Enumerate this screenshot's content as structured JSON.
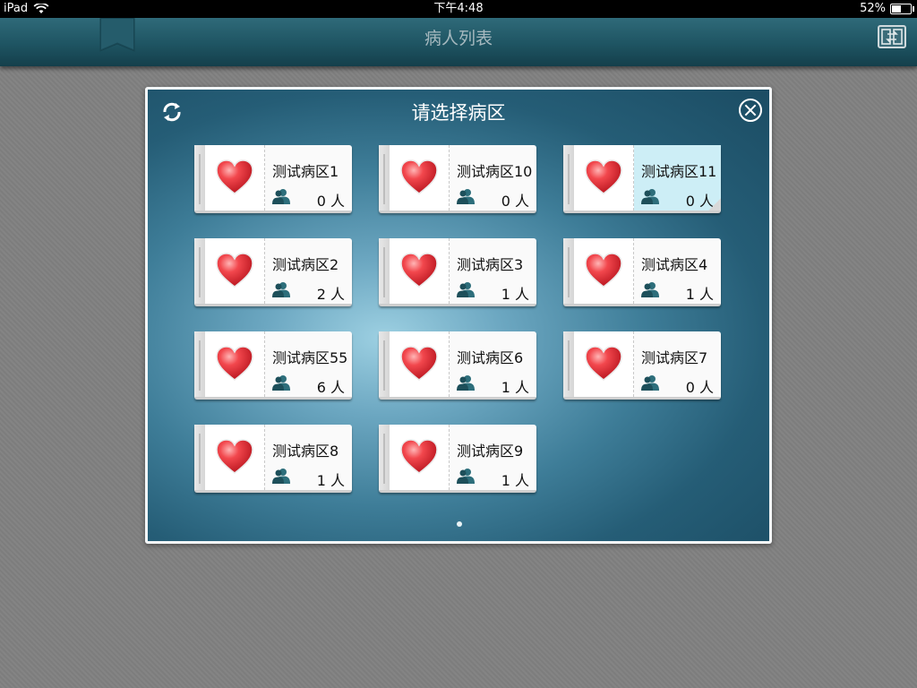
{
  "status_bar": {
    "carrier": "iPad",
    "time": "下午4:48",
    "battery": "52%",
    "battery_level": 0.52
  },
  "nav": {
    "title": "病人列表",
    "icons": {
      "bookmark": "bookmark-icon",
      "switch": "switch-view-icon"
    }
  },
  "modal": {
    "title": "请选择病区",
    "icons": {
      "refresh": "refresh-icon",
      "close": "close-icon"
    },
    "wards": [
      {
        "name": "测试病区1",
        "count": "0 人",
        "selected": false
      },
      {
        "name": "测试病区10",
        "count": "0 人",
        "selected": false
      },
      {
        "name": "测试病区11",
        "count": "0 人",
        "selected": true
      },
      {
        "name": "测试病区2",
        "count": "2 人",
        "selected": false
      },
      {
        "name": "测试病区3",
        "count": "1 人",
        "selected": false
      },
      {
        "name": "测试病区4",
        "count": "1 人",
        "selected": false
      },
      {
        "name": "测试病区55",
        "count": "6 人",
        "selected": false
      },
      {
        "name": "测试病区6",
        "count": "1 人",
        "selected": false
      },
      {
        "name": "测试病区7",
        "count": "0 人",
        "selected": false
      },
      {
        "name": "测试病区8",
        "count": "1 人",
        "selected": false
      },
      {
        "name": "测试病区9",
        "count": "1 人",
        "selected": false
      }
    ],
    "page_count": 1,
    "current_page": 1
  },
  "colors": {
    "nav_bar": "#1e5462",
    "selected_card": "#cdeef6",
    "heart": "#e0262f"
  }
}
